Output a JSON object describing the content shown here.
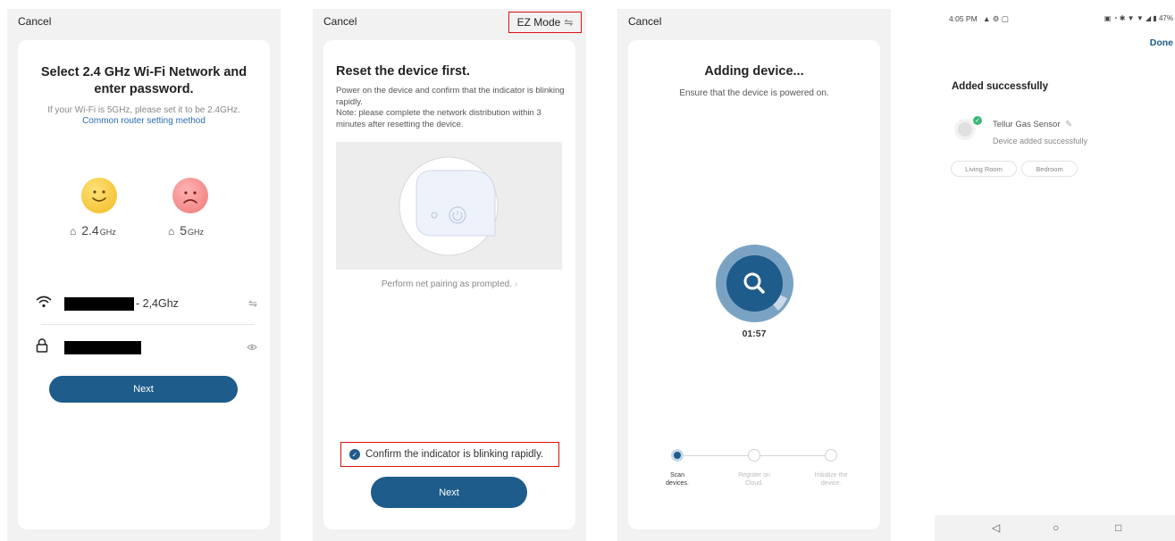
{
  "screen1": {
    "cancel": "Cancel",
    "title": "Select 2.4 GHz Wi-Fi Network and enter password.",
    "subtitle": "If your Wi-Fi is 5GHz, please set it to be 2.4GHz.",
    "router_link": "Common router setting method",
    "band_24": {
      "value": "2.4",
      "unit": "GHz"
    },
    "band_5": {
      "value": "5",
      "unit": "GHz"
    },
    "ssid_suffix": "- 2,4Ghz",
    "next": "Next"
  },
  "screen2": {
    "cancel": "Cancel",
    "mode": "EZ Mode",
    "title": "Reset the device first.",
    "desc_1": "Power on the device and confirm that the indicator is blinking rapidly.",
    "desc_2": "Note: please complete the network distribution within 3 minutes after resetting the device.",
    "pair_link": "Perform net pairing as prompted.",
    "confirm": "Confirm the indicator is blinking rapidly.",
    "next": "Next"
  },
  "screen3": {
    "cancel": "Cancel",
    "title": "Adding device...",
    "subtitle": "Ensure that the device is powered on.",
    "timer": "01:57",
    "steps": [
      {
        "line1": "Scan",
        "line2": "devices."
      },
      {
        "line1": "Register on",
        "line2": "Cloud."
      },
      {
        "line1": "Initialize the",
        "line2": "device."
      }
    ]
  },
  "screen4": {
    "status_time": "4:05 PM",
    "battery": "47%",
    "done": "Done",
    "added_title": "Added successfully",
    "device_name": "Tellur Gas Sensor",
    "device_status": "Device added successfully",
    "rooms": [
      "Living Room",
      "Bedroom"
    ]
  },
  "colors": {
    "primary": "#1d5c8b",
    "highlight": "#d11111",
    "success": "#3cb878",
    "link": "#2b6cb0"
  },
  "icons": [
    "wifi-icon",
    "lock-icon",
    "swap-icon",
    "eye-icon",
    "router-icon",
    "search-icon",
    "check-icon",
    "edit-icon",
    "power-icon",
    "back-nav-icon",
    "home-nav-icon",
    "recent-nav-icon"
  ]
}
